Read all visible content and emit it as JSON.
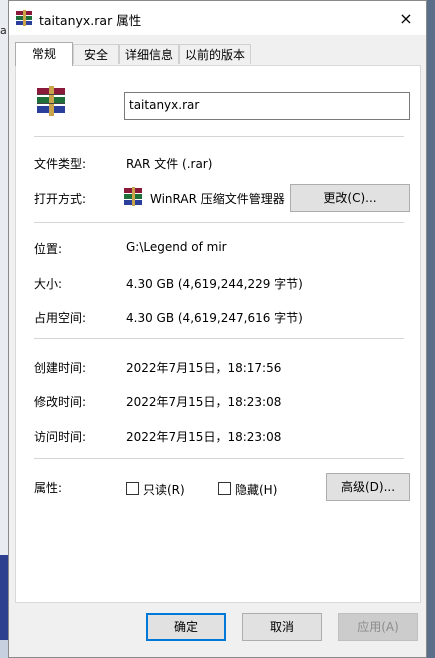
{
  "background": {
    "left_fragment": "a"
  },
  "window": {
    "title": "taitanyx.rar 属性",
    "close_icon": "×",
    "icon": "winrar-archive-icon"
  },
  "tabs": [
    {
      "label": "常规",
      "active": true
    },
    {
      "label": "安全"
    },
    {
      "label": "详细信息"
    },
    {
      "label": "以前的版本"
    }
  ],
  "general": {
    "file_name": "taitanyx.rar",
    "file_type_label": "文件类型:",
    "file_type_value": "RAR 文件 (.rar)",
    "open_with_label": "打开方式:",
    "open_with_app": "WinRAR 压缩文件管理器",
    "change_button": "更改(C)...",
    "location_label": "位置:",
    "location_value": "G:\\Legend of mir",
    "size_label": "大小:",
    "size_value": "4.30 GB (4,619,244,229 字节)",
    "disk_size_label": "占用空间:",
    "disk_size_value": "4.30 GB (4,619,247,616 字节)",
    "created_label": "创建时间:",
    "created_value": "2022年7月15日，18:17:56",
    "modified_label": "修改时间:",
    "modified_value": "2022年7月15日，18:23:08",
    "accessed_label": "访问时间:",
    "accessed_value": "2022年7月15日，18:23:08",
    "attributes_label": "属性:",
    "readonly_label": "只读(R)",
    "readonly_checked": false,
    "hidden_label": "隐藏(H)",
    "hidden_checked": false,
    "advanced_button": "高级(D)..."
  },
  "footer": {
    "ok": "确定",
    "cancel": "取消",
    "apply": "应用(A)"
  }
}
